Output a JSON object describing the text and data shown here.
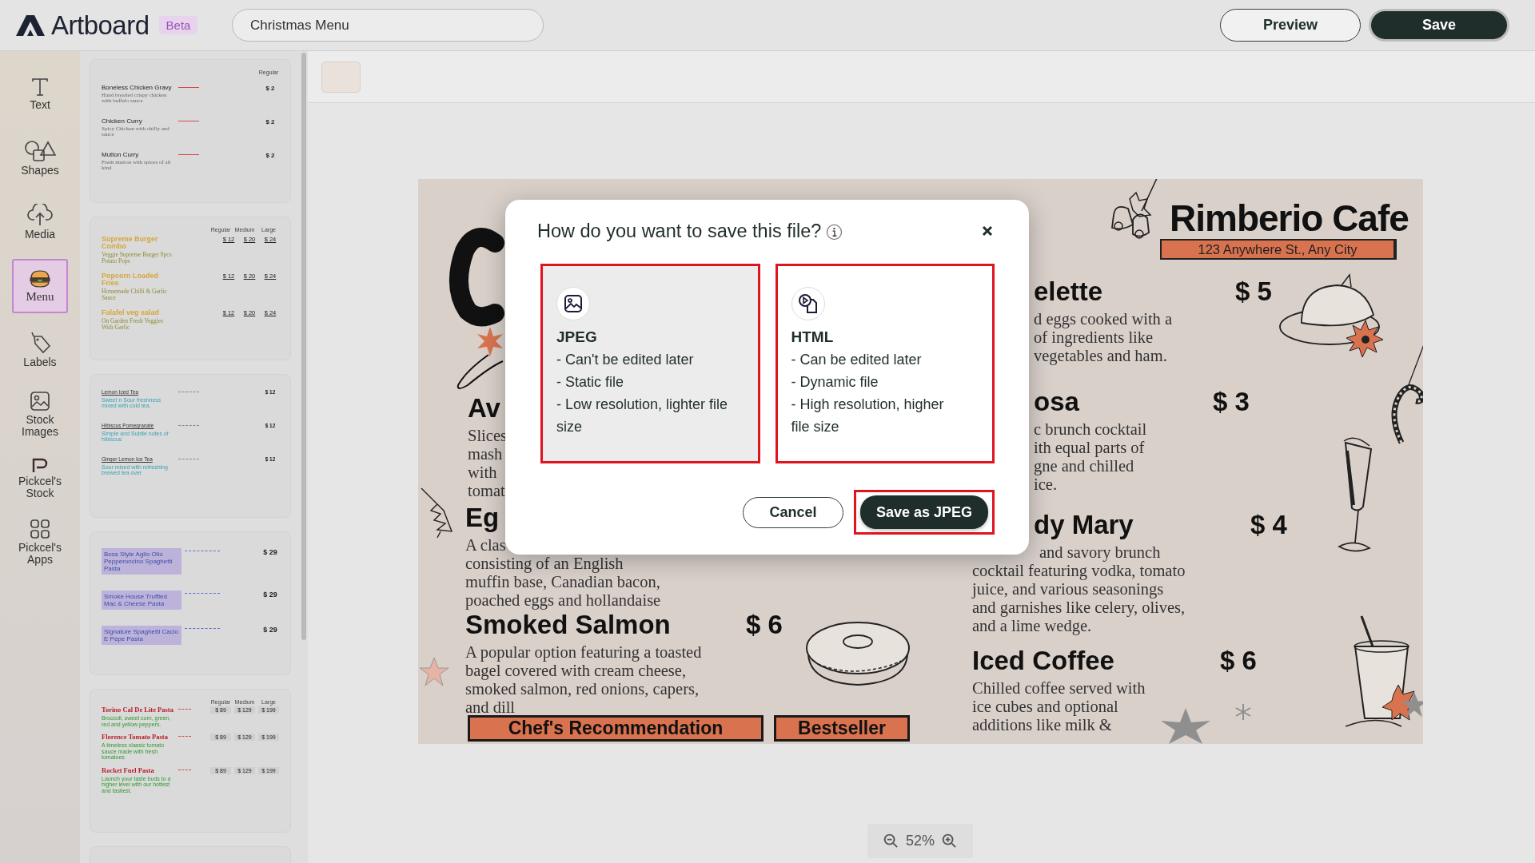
{
  "app": {
    "logo": "Artboard",
    "badge": "Beta"
  },
  "document": {
    "title": "Christmas Menu"
  },
  "header_buttons": [
    {
      "label": "Preview",
      "kind": "secondary"
    },
    {
      "label": "Save",
      "kind": "primary"
    }
  ],
  "tools": [
    {
      "label": "Text",
      "selected": false
    },
    {
      "label": "Shapes",
      "selected": false
    },
    {
      "label": "Media",
      "selected": false
    },
    {
      "label": "Menu",
      "selected": true
    },
    {
      "label": "Labels",
      "selected": false
    },
    {
      "label": "Stock Images",
      "selected": false
    },
    {
      "label": "Pickcel's Stock",
      "selected": false
    },
    {
      "label": "Pickcel's Apps",
      "selected": false
    }
  ],
  "templates": [
    {
      "kind": "classic",
      "columns": [
        "Regular"
      ],
      "items": [
        {
          "name": "Boneless Chicken Gravy",
          "desc": "Hand breaded crispy chicken with buffalo sauce",
          "prices": [
            "$ 2"
          ]
        },
        {
          "name": "Chicken Curry",
          "desc": "Spicy Chicken with chilly and sauce",
          "prices": [
            "$ 2"
          ]
        },
        {
          "name": "Mutton Curry",
          "desc": "Fresh mutton with spices of all kind",
          "prices": [
            "$ 2"
          ]
        }
      ]
    },
    {
      "kind": "combo",
      "columns": [
        "Regular",
        "Medium",
        "Large"
      ],
      "items": [
        {
          "name": "Supreme Burger Combo",
          "desc": "Veggie Supreme Burger 8pcs Potato Pops",
          "prices": [
            "$ 12",
            "$ 20",
            "$ 24"
          ]
        },
        {
          "name": "Popcorn Loaded Fries",
          "desc": "Homemade Chilli & Garlic Sauce",
          "prices": [
            "$ 12",
            "$ 20",
            "$ 24"
          ]
        },
        {
          "name": "Falafel veg salad",
          "desc": "On Garden Fresh Veggies With Garlic",
          "prices": [
            "$ 12",
            "$ 20",
            "$ 24"
          ]
        }
      ]
    },
    {
      "kind": "tea",
      "items": [
        {
          "name": "Lemon Iced Tea",
          "desc": "Sweet n Sour freshness mixed with cold tea.",
          "prices": [
            "$ 12"
          ]
        },
        {
          "name": "Hibiscus Pomegranate",
          "desc": "Simple and Subtle notes of hibiscus",
          "prices": [
            "$ 12"
          ]
        },
        {
          "name": "Ginger Lemon Ice Tea",
          "desc": "Sour mixed with refreshing brewed tea over",
          "prices": [
            "$ 12"
          ]
        }
      ]
    },
    {
      "kind": "highlight",
      "items": [
        {
          "name": "Boss Style Aglio Olio Pepperoncino Spaghetti Pasta",
          "prices": [
            "$ 29"
          ]
        },
        {
          "name": "Smoke House Truffled Mac & Cheese Pasta",
          "prices": [
            "$ 29"
          ]
        },
        {
          "name": "Signature Spaghetti Cacio E Pepe Pasta",
          "prices": [
            "$ 29"
          ]
        }
      ]
    },
    {
      "kind": "boxed",
      "columns": [
        "Regular",
        "Medium",
        "Large"
      ],
      "items": [
        {
          "name": "Torino Cal De Lite Pasta",
          "desc": "Broccoli, sweet corn, green, red and yellow peppers.",
          "prices": [
            "$ 89",
            "$ 129",
            "$ 199"
          ]
        },
        {
          "name": "Florence Tomato Pasta",
          "desc": "A timeless classic tomato sauce made with fresh tomatoes",
          "prices": [
            "$ 89",
            "$ 129",
            "$ 199"
          ]
        },
        {
          "name": "Rocket Fuel Pasta",
          "desc": "Launch your taste buds to a higher level with our hottest and tastiest.",
          "prices": [
            "$ 89",
            "$ 129",
            "$ 199"
          ]
        }
      ]
    },
    {
      "kind": "blank"
    }
  ],
  "artboard": {
    "cafe_name": "Rimberio Cafe",
    "address": "123 Anywhere St., Any City",
    "items": [
      {
        "name": "Av",
        "desc": [
          "Slices",
          "mash",
          "with",
          "tomat"
        ]
      },
      {
        "name": "Eg",
        "desc": [
          "A clas",
          "consisting of an English",
          "muffin base, Canadian bacon,",
          "poached eggs and hollandaise"
        ]
      },
      {
        "name": "Smoked Salmon",
        "price": "$ 6",
        "desc": [
          "A popular option featuring a toasted",
          "bagel covered with cream cheese,",
          "smoked salmon, red onions, capers,",
          "and dill"
        ]
      },
      {
        "name": "elette",
        "price": "$ 5",
        "desc": [
          "d eggs cooked with a",
          "of ingredients like",
          "vegetables and ham."
        ]
      },
      {
        "name": "osa",
        "price": "$ 3",
        "desc": [
          "c brunch cocktail",
          "ith equal parts of",
          "gne and chilled",
          "ice."
        ]
      },
      {
        "name": "dy Mary",
        "price": "$ 4",
        "desc": [
          "and savory brunch",
          "cocktail featuring vodka, tomato",
          "juice, and various seasonings",
          "and garnishes like celery, olives,",
          "and a lime wedge."
        ]
      },
      {
        "name": "Iced Coffee",
        "price": "$ 6",
        "desc": [
          "Chilled coffee served with",
          "ice cubes and optional",
          "additions like milk &"
        ]
      }
    ],
    "banners": [
      "Chef's Recommendation",
      "Bestseller"
    ]
  },
  "zoom": {
    "value": "52%"
  },
  "dialog": {
    "title": "How do you want to save this file?",
    "options": [
      {
        "title": "JPEG",
        "lines": [
          "- Can't be edited later",
          "- Static file",
          "- Low resolution, lighter file size"
        ],
        "selected": true
      },
      {
        "title": "HTML",
        "lines": [
          "- Can be edited later",
          "- Dynamic file",
          "- High resolution, higher file size"
        ],
        "selected": false
      }
    ],
    "buttons": [
      {
        "label": "Cancel",
        "kind": "secondary"
      },
      {
        "label": "Save as JPEG",
        "kind": "primary"
      }
    ]
  }
}
